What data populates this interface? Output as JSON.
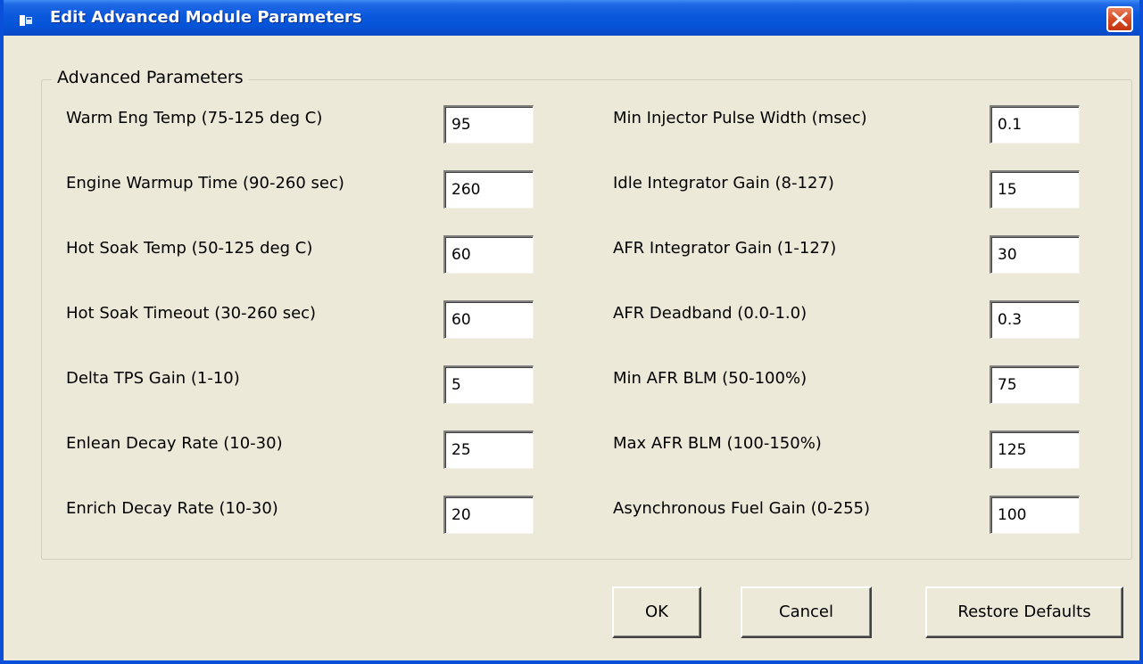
{
  "window": {
    "title": "Edit Advanced Module Parameters"
  },
  "group": {
    "label": "Advanced Parameters"
  },
  "left_params": [
    {
      "label": "Warm Eng Temp (75-125 deg C)",
      "value": "95"
    },
    {
      "label": "Engine Warmup Time (90-260 sec)",
      "value": "260"
    },
    {
      "label": "Hot Soak Temp (50-125 deg C)",
      "value": "60"
    },
    {
      "label": "Hot Soak Timeout (30-260 sec)",
      "value": "60"
    },
    {
      "label": "Delta TPS Gain (1-10)",
      "value": "5"
    },
    {
      "label": "Enlean Decay Rate (10-30)",
      "value": "25"
    },
    {
      "label": "Enrich Decay Rate (10-30)",
      "value": "20"
    }
  ],
  "right_params": [
    {
      "label": "Min Injector Pulse Width (msec)",
      "value": "0.1"
    },
    {
      "label": "Idle Integrator Gain (8-127)",
      "value": "15"
    },
    {
      "label": "AFR Integrator Gain (1-127)",
      "value": "30"
    },
    {
      "label": "AFR Deadband (0.0-1.0)",
      "value": "0.3"
    },
    {
      "label": "Min AFR BLM (50-100%)",
      "value": "75"
    },
    {
      "label": "Max AFR BLM (100-150%)",
      "value": "125"
    },
    {
      "label": "Asynchronous Fuel Gain (0-255)",
      "value": "100"
    }
  ],
  "buttons": {
    "ok": "OK",
    "cancel": "Cancel",
    "restore": "Restore Defaults"
  },
  "colors": {
    "titlebar": "#0553d6",
    "window_bg": "#ece9d8",
    "close": "#d74b25"
  },
  "icons": {
    "title": "app-window-icon",
    "close": "close-icon"
  }
}
